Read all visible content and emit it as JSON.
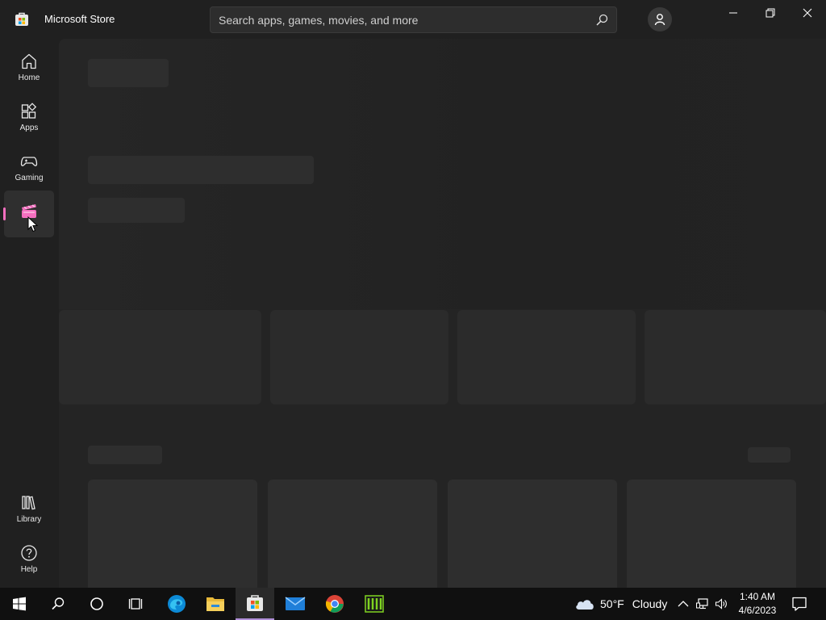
{
  "window": {
    "title": "Microsoft Store",
    "controls": [
      "minimize",
      "restore",
      "close"
    ]
  },
  "search": {
    "placeholder": "Search apps, games, movies, and more",
    "value": ""
  },
  "sidebar": {
    "items": [
      {
        "label": "Home",
        "icon": "home-icon"
      },
      {
        "label": "Apps",
        "icon": "apps-icon"
      },
      {
        "label": "Gaming",
        "icon": "gaming-icon"
      },
      {
        "label": "",
        "icon": "movies-tv-icon",
        "active": true
      },
      {
        "label": "Library",
        "icon": "library-icon"
      },
      {
        "label": "Help",
        "icon": "help-icon"
      }
    ],
    "active_color": "#f46fbf"
  },
  "taskbar": {
    "apps": [
      "start-icon",
      "search-icon",
      "cortana-icon",
      "task-view-icon",
      "edge-icon",
      "file-explorer-icon",
      "store-icon",
      "mail-icon",
      "chrome-icon",
      "app-icon"
    ],
    "active_app": "store-icon",
    "weather": {
      "temp": "50°F",
      "condition": "Cloudy"
    },
    "clock": {
      "time": "1:40 AM",
      "date": "4/6/2023"
    }
  }
}
